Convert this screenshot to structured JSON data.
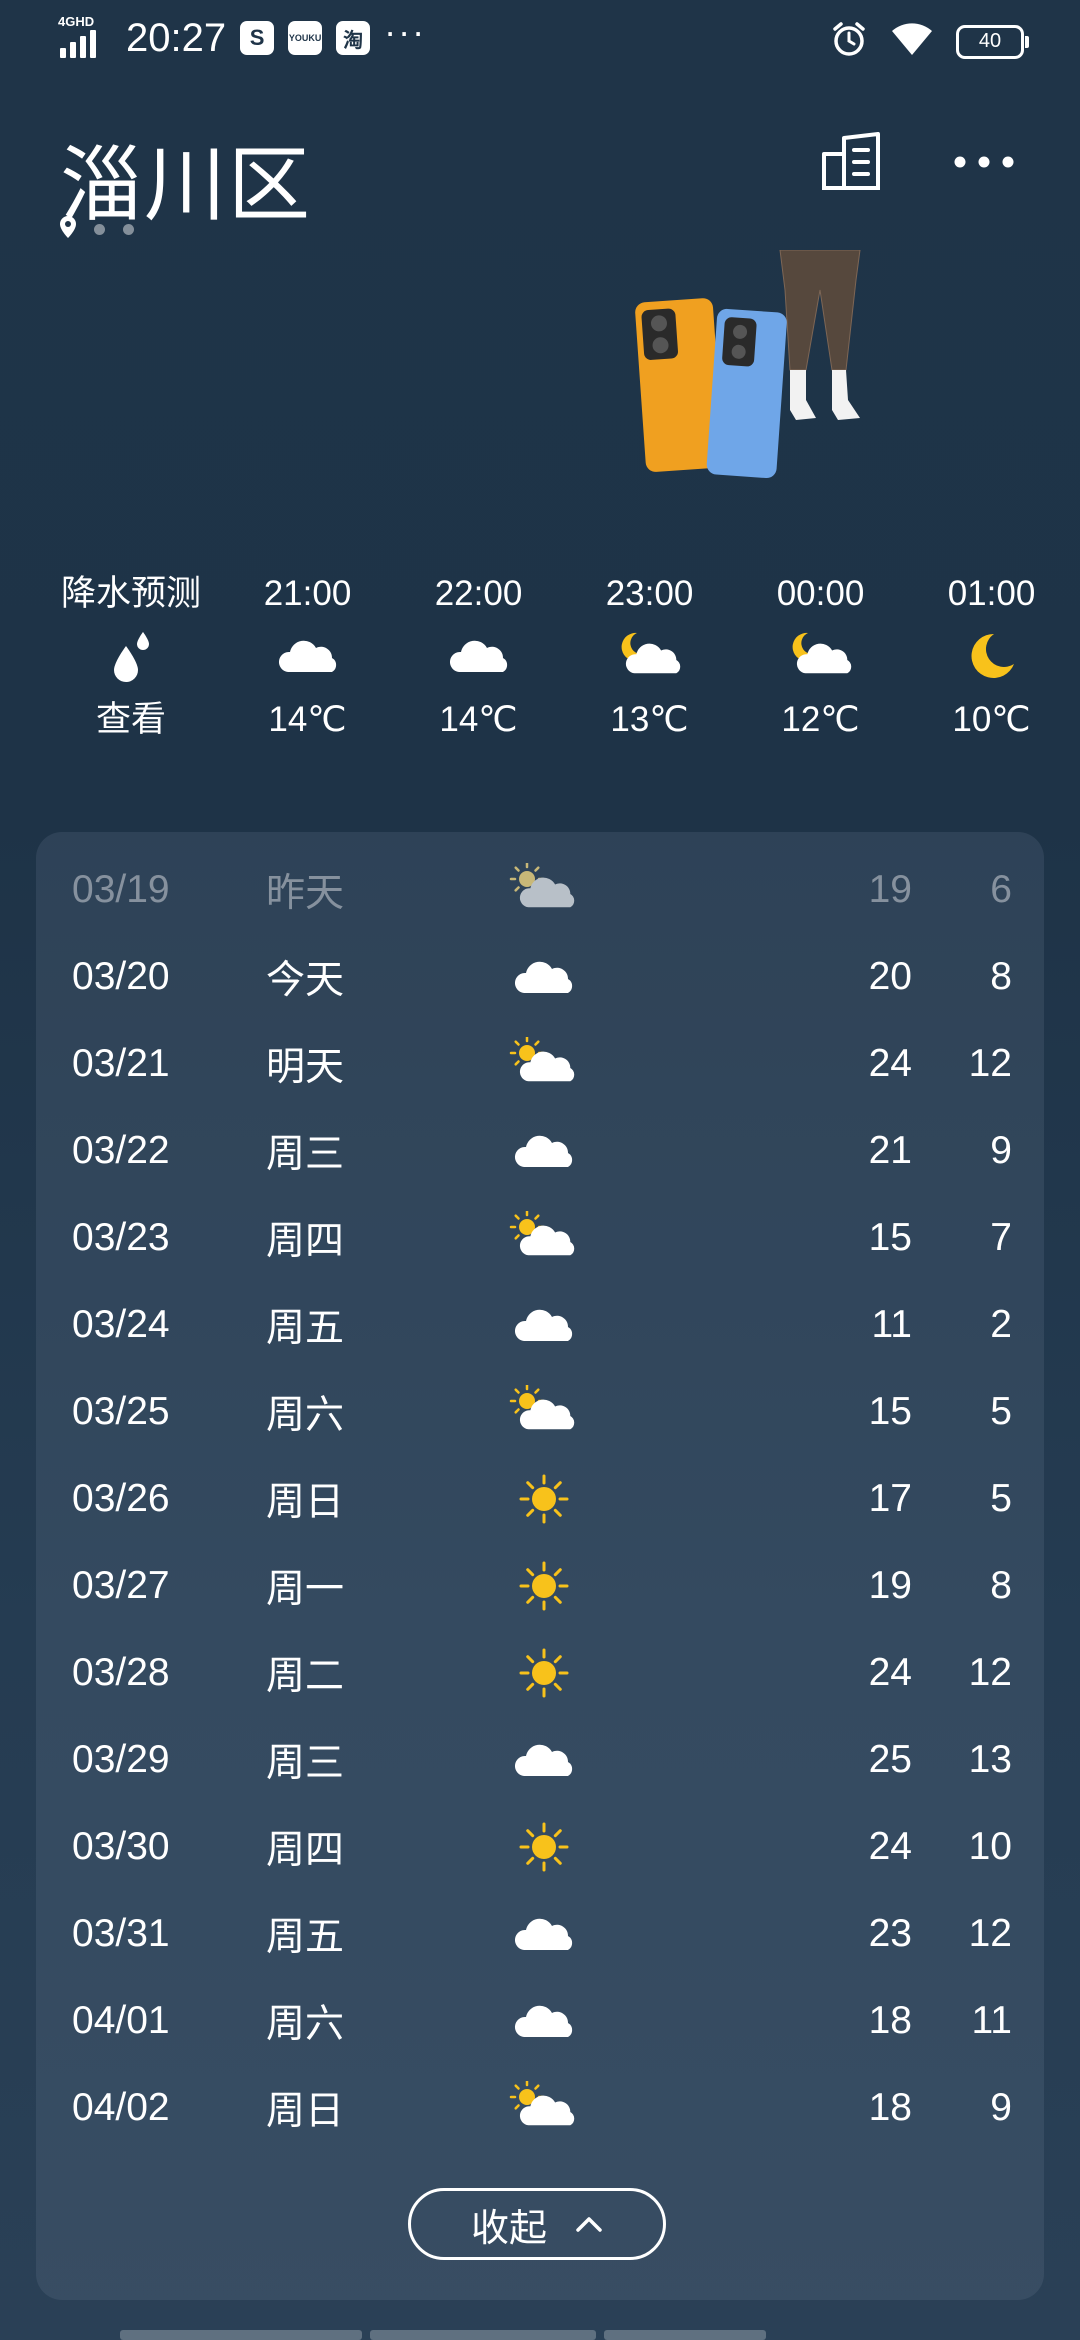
{
  "status_bar": {
    "network": "4GHD",
    "time": "20:27",
    "app_icons": [
      "S",
      "YOUKU",
      "淘"
    ],
    "more": "···",
    "battery": "40",
    "icons": [
      "signal-icon",
      "alarm-icon",
      "wifi-icon",
      "battery-icon"
    ]
  },
  "header": {
    "city": "淄川区",
    "page_count": 3,
    "buttons": [
      "city-manage-icon",
      "more-icon"
    ]
  },
  "hourly": [
    {
      "time": "降水预测",
      "icon": "raindrop-icon",
      "value": "查看"
    },
    {
      "time": "21:00",
      "icon": "cloud-icon",
      "value": "14℃"
    },
    {
      "time": "22:00",
      "icon": "cloud-icon",
      "value": "14℃"
    },
    {
      "time": "23:00",
      "icon": "moon-cloud-icon",
      "value": "13℃"
    },
    {
      "time": "00:00",
      "icon": "moon-cloud-icon",
      "value": "12℃"
    },
    {
      "time": "01:00",
      "icon": "moon-icon",
      "value": "10℃"
    }
  ],
  "daily": [
    {
      "date": "03/19",
      "label": "昨天",
      "icon": "sun-cloud-icon",
      "high": "19",
      "low": "6",
      "past": true
    },
    {
      "date": "03/20",
      "label": "今天",
      "icon": "cloud-icon",
      "high": "20",
      "low": "8"
    },
    {
      "date": "03/21",
      "label": "明天",
      "icon": "sun-cloud-icon",
      "high": "24",
      "low": "12"
    },
    {
      "date": "03/22",
      "label": "周三",
      "icon": "cloud-icon",
      "high": "21",
      "low": "9"
    },
    {
      "date": "03/23",
      "label": "周四",
      "icon": "sun-cloud-icon",
      "high": "15",
      "low": "7"
    },
    {
      "date": "03/24",
      "label": "周五",
      "icon": "cloud-icon",
      "high": "11",
      "low": "2"
    },
    {
      "date": "03/25",
      "label": "周六",
      "icon": "sun-cloud-icon",
      "high": "15",
      "low": "5"
    },
    {
      "date": "03/26",
      "label": "周日",
      "icon": "sun-icon",
      "high": "17",
      "low": "5"
    },
    {
      "date": "03/27",
      "label": "周一",
      "icon": "sun-icon",
      "high": "19",
      "low": "8"
    },
    {
      "date": "03/28",
      "label": "周二",
      "icon": "sun-icon",
      "high": "24",
      "low": "12"
    },
    {
      "date": "03/29",
      "label": "周三",
      "icon": "cloud-icon",
      "high": "25",
      "low": "13"
    },
    {
      "date": "03/30",
      "label": "周四",
      "icon": "sun-icon",
      "high": "24",
      "low": "10"
    },
    {
      "date": "03/31",
      "label": "周五",
      "icon": "cloud-icon",
      "high": "23",
      "low": "12"
    },
    {
      "date": "04/01",
      "label": "周六",
      "icon": "cloud-icon",
      "high": "18",
      "low": "11"
    },
    {
      "date": "04/02",
      "label": "周日",
      "icon": "sun-cloud-icon",
      "high": "18",
      "low": "9"
    }
  ],
  "collapse_label": "收起",
  "colors": {
    "background": "#1f3448",
    "sun": "#f8c21b",
    "cloud": "#ffffff",
    "past_cloud": "#b8c0c8"
  }
}
